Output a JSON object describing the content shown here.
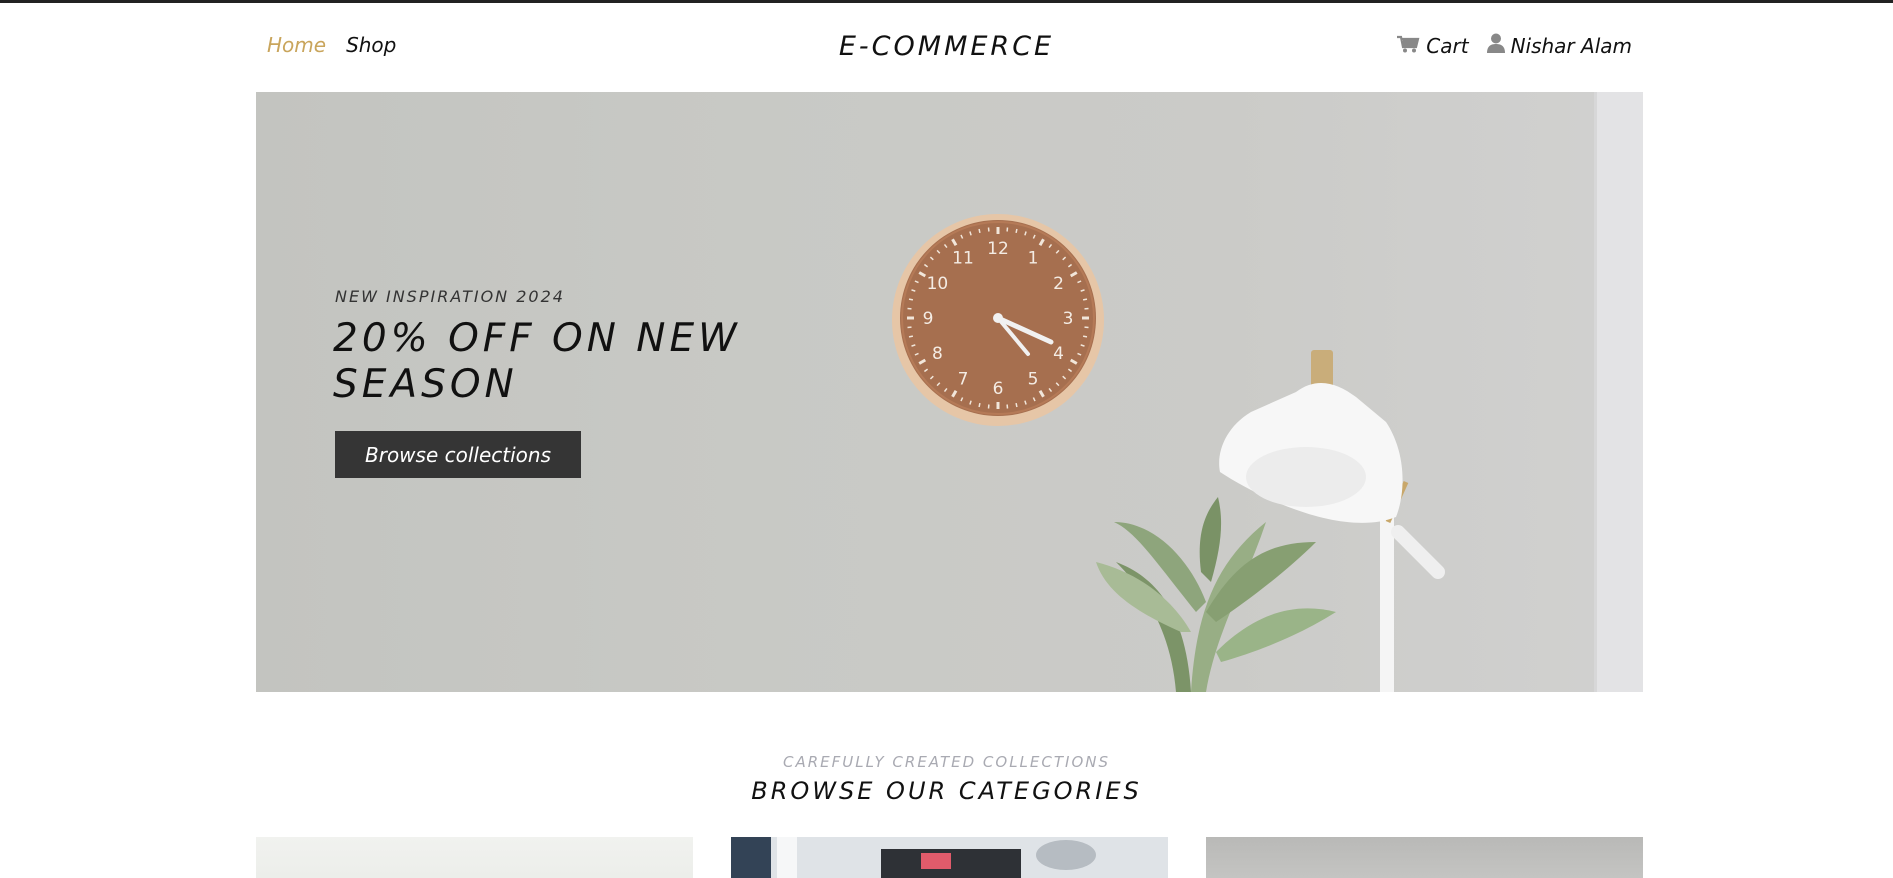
{
  "header": {
    "nav": {
      "home": "Home",
      "shop": "Shop"
    },
    "brand": "E-COMMERCE",
    "cart_label": "Cart",
    "user_name": "Nishar Alam",
    "icons": {
      "cart": "cart-icon",
      "user": "user-icon"
    },
    "colors": {
      "active_link": "#c9a55c"
    }
  },
  "hero": {
    "kicker": "NEW INSPIRATION 2024",
    "title": "20% OFF ON NEW SEASON",
    "button_label": "Browse collections",
    "clock_numbers": [
      "12",
      "1",
      "2",
      "3",
      "4",
      "5",
      "6",
      "7",
      "8",
      "9",
      "10",
      "11"
    ]
  },
  "categories": {
    "kicker": "CAREFULLY CREATED COLLECTIONS",
    "title": "BROWSE OUR CATEGORIES"
  }
}
